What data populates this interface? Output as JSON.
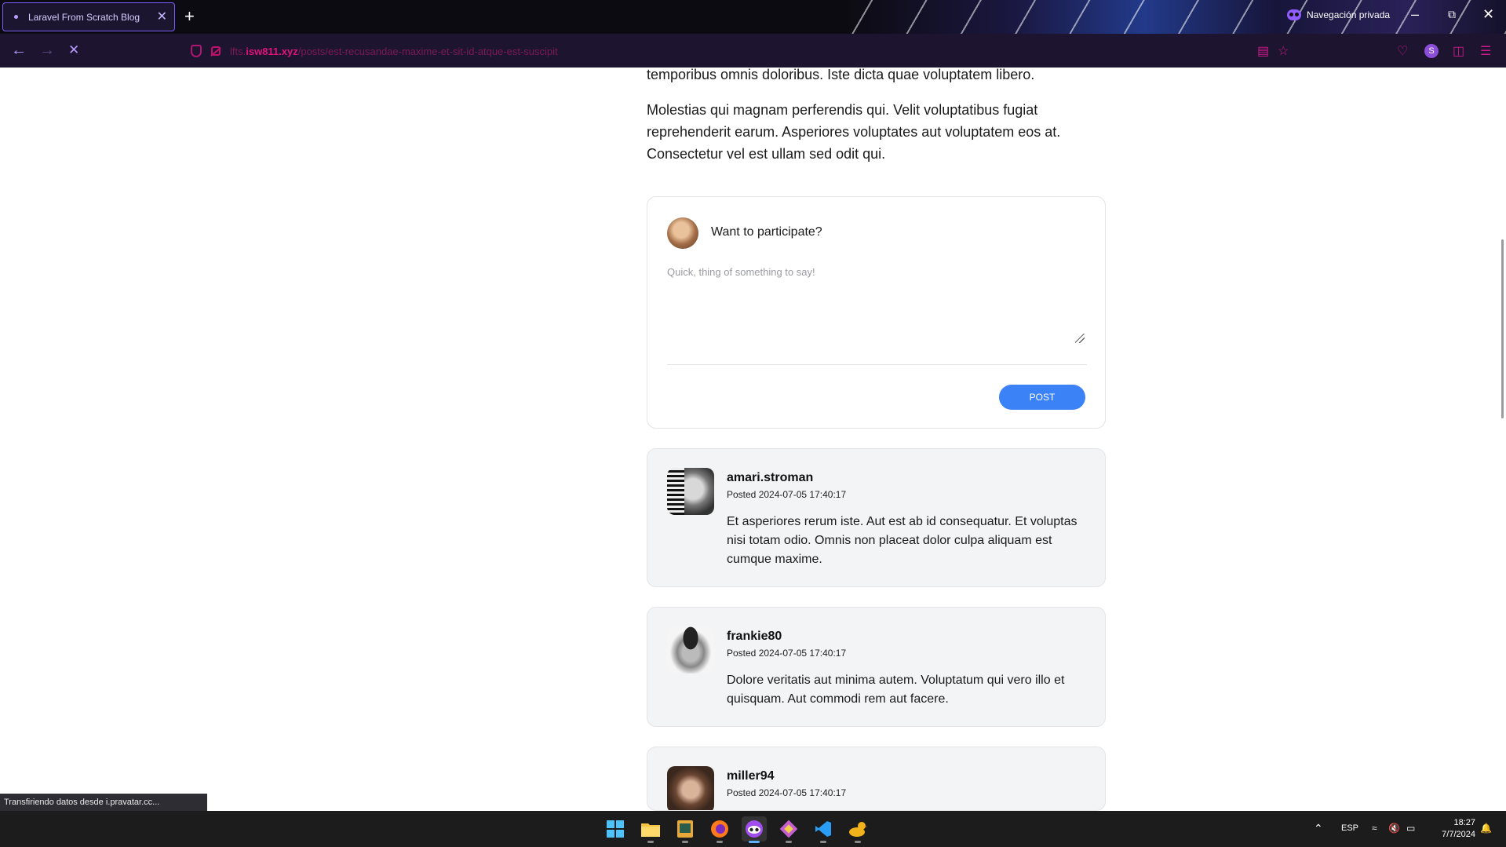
{
  "browser": {
    "tab_title": "Laravel From Scratch Blog",
    "tab_close": "✕",
    "new_tab": "+",
    "private_label": "Navegación privada",
    "url_prefix": "lfts.",
    "url_domain": "isw811.xyz",
    "url_path": "/posts/est-recusandae-maxime-et-sit-id-atque-est-suscipit",
    "profile_initial": "S",
    "status_text": "Transfiriendo datos desde i.pravatar.cc..."
  },
  "article": {
    "paragraph_end": "temporibus omnis doloribus. Iste dicta quae voluptatem libero.",
    "paragraph_last": "Molestias qui magnam perferendis qui. Velit voluptatibus fugiat reprehenderit earum. Asperiores voluptates aut voluptatem eos at. Consectetur vel est ullam sed odit qui."
  },
  "composer": {
    "title": "Want to participate?",
    "placeholder": "Quick, thing of something to say!",
    "post_label": "POST"
  },
  "comments": [
    {
      "author": "amari.stroman",
      "posted": "Posted 2024-07-05 17:40:17",
      "body": "Et asperiores rerum iste. Aut est ab id consequatur. Et voluptas nisi totam odio. Omnis non placeat dolor culpa aliquam est cumque maxime."
    },
    {
      "author": "frankie80",
      "posted": "Posted 2024-07-05 17:40:17",
      "body": "Dolore veritatis aut minima autem. Voluptatum qui vero illo et quisquam. Aut commodi rem aut facere."
    },
    {
      "author": "miller94",
      "posted": "Posted 2024-07-05 17:40:17",
      "body": ""
    }
  ],
  "taskbar": {
    "language": "ESP",
    "time": "18:27",
    "date": "7/7/2024"
  },
  "colors": {
    "accent_blue": "#3b82f6",
    "url_pink": "#e0127a",
    "card_bg": "#f3f4f6"
  }
}
